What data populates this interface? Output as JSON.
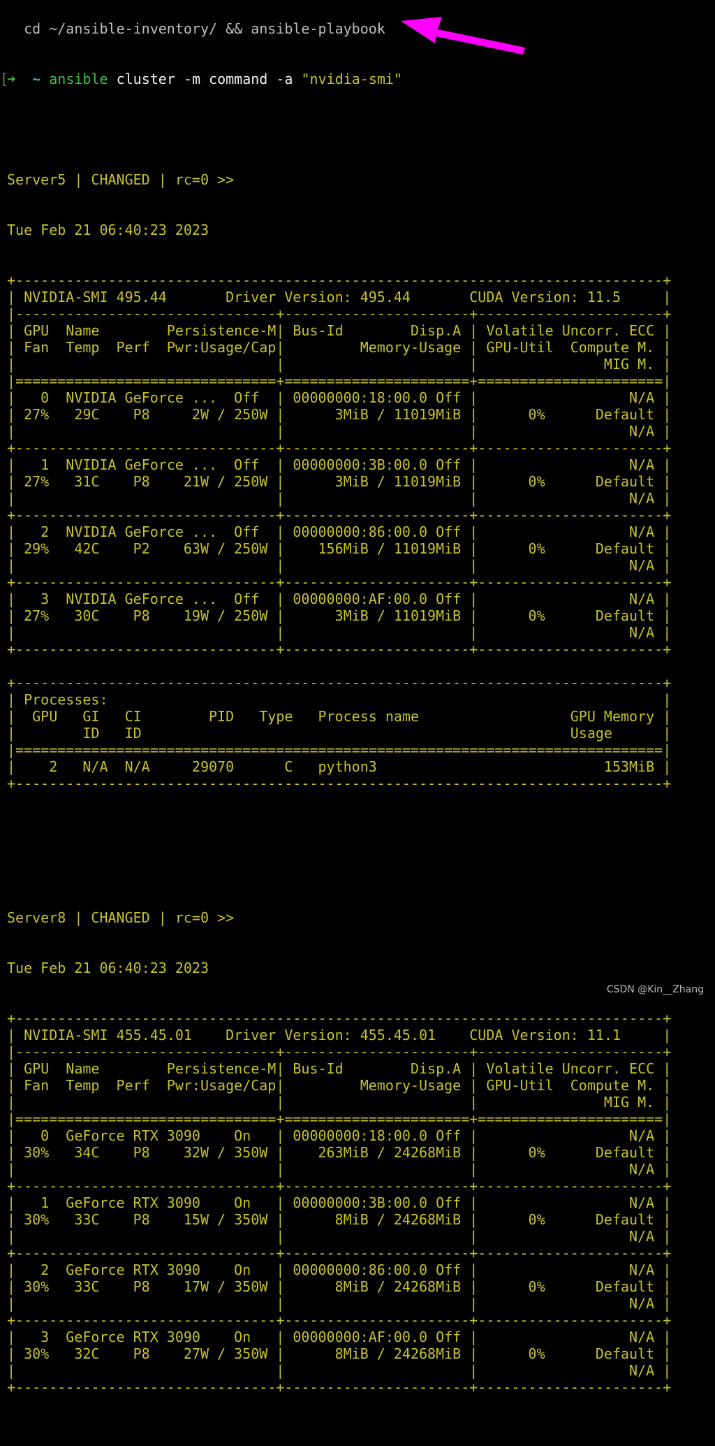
{
  "terminal": {
    "previous_line": "  cd ~/ansible-inventory/ && ansible-playbook",
    "prompt": {
      "bracket": "[",
      "arrow": "➜",
      "cwd": "~",
      "command": "ansible",
      "args": " cluster -m command -a ",
      "string_arg": "\"nvidia-smi\""
    },
    "annotation": {
      "type": "arrow-icon",
      "color": "#ff00ff",
      "points_to": "nvidia-smi command"
    },
    "servers": [
      {
        "header": "Server5 | CHANGED | rc=0 >>",
        "timestamp": "Tue Feb 21 06:40:23 2023",
        "smi_lines": [
          "+-----------------------------------------------------------------------------+",
          "| NVIDIA-SMI 495.44       Driver Version: 495.44       CUDA Version: 11.5     |",
          "|-------------------------------+----------------------+----------------------+",
          "| GPU  Name        Persistence-M| Bus-Id        Disp.A | Volatile Uncorr. ECC |",
          "| Fan  Temp  Perf  Pwr:Usage/Cap|         Memory-Usage | GPU-Util  Compute M. |",
          "|                               |                      |               MIG M. |",
          "|===============================+======================+======================|",
          "|   0  NVIDIA GeForce ...  Off  | 00000000:18:00.0 Off |                  N/A |",
          "| 27%   29C    P8     2W / 250W |      3MiB / 11019MiB |      0%      Default |",
          "|                               |                      |                  N/A |",
          "+-------------------------------+----------------------+----------------------+",
          "|   1  NVIDIA GeForce ...  Off  | 00000000:3B:00.0 Off |                  N/A |",
          "| 27%   31C    P8    21W / 250W |      3MiB / 11019MiB |      0%      Default |",
          "|                               |                      |                  N/A |",
          "+-------------------------------+----------------------+----------------------+",
          "|   2  NVIDIA GeForce ...  Off  | 00000000:86:00.0 Off |                  N/A |",
          "| 29%   42C    P2    63W / 250W |    156MiB / 11019MiB |      0%      Default |",
          "|                               |                      |                  N/A |",
          "+-------------------------------+----------------------+----------------------+",
          "|   3  NVIDIA GeForce ...  Off  | 00000000:AF:00.0 Off |                  N/A |",
          "| 27%   30C    P8    19W / 250W |      3MiB / 11019MiB |      0%      Default |",
          "|                               |                      |                  N/A |",
          "+-------------------------------+----------------------+----------------------+",
          "",
          "+-----------------------------------------------------------------------------+",
          "| Processes:                                                                  |",
          "|  GPU   GI   CI        PID   Type   Process name                  GPU Memory |",
          "|        ID   ID                                                   Usage      |",
          "|=============================================================================|",
          "|    2   N/A  N/A     29070      C   python3                           153MiB |",
          "+-----------------------------------------------------------------------------+"
        ],
        "summary": {
          "nvidia_smi_version": "495.44",
          "driver_version": "495.44",
          "cuda_version": "11.5",
          "gpus": [
            {
              "id": "0",
              "name": "NVIDIA GeForce ...",
              "persistence": "Off",
              "bus_id": "00000000:18:00.0",
              "disp": "Off",
              "ecc": "N/A",
              "fan": "27%",
              "temp": "29C",
              "perf": "P8",
              "power": "2W / 250W",
              "memory": "3MiB / 11019MiB",
              "util": "0%",
              "compute": "Default",
              "mig": "N/A"
            },
            {
              "id": "1",
              "name": "NVIDIA GeForce ...",
              "persistence": "Off",
              "bus_id": "00000000:3B:00.0",
              "disp": "Off",
              "ecc": "N/A",
              "fan": "27%",
              "temp": "31C",
              "perf": "P8",
              "power": "21W / 250W",
              "memory": "3MiB / 11019MiB",
              "util": "0%",
              "compute": "Default",
              "mig": "N/A"
            },
            {
              "id": "2",
              "name": "NVIDIA GeForce ...",
              "persistence": "Off",
              "bus_id": "00000000:86:00.0",
              "disp": "Off",
              "ecc": "N/A",
              "fan": "29%",
              "temp": "42C",
              "perf": "P2",
              "power": "63W / 250W",
              "memory": "156MiB / 11019MiB",
              "util": "0%",
              "compute": "Default",
              "mig": "N/A"
            },
            {
              "id": "3",
              "name": "NVIDIA GeForce ...",
              "persistence": "Off",
              "bus_id": "00000000:AF:00.0",
              "disp": "Off",
              "ecc": "N/A",
              "fan": "27%",
              "temp": "30C",
              "perf": "P8",
              "power": "19W / 250W",
              "memory": "3MiB / 11019MiB",
              "util": "0%",
              "compute": "Default",
              "mig": "N/A"
            }
          ],
          "processes": [
            {
              "gpu": "2",
              "gi_id": "N/A",
              "ci_id": "N/A",
              "pid": "29070",
              "type": "C",
              "name": "python3",
              "memory": "153MiB"
            }
          ]
        }
      },
      {
        "header": "Server8 | CHANGED | rc=0 >>",
        "timestamp": "Tue Feb 21 06:40:23 2023",
        "smi_lines": [
          "+-----------------------------------------------------------------------------+",
          "| NVIDIA-SMI 455.45.01    Driver Version: 455.45.01    CUDA Version: 11.1     |",
          "|-------------------------------+----------------------+----------------------+",
          "| GPU  Name        Persistence-M| Bus-Id        Disp.A | Volatile Uncorr. ECC |",
          "| Fan  Temp  Perf  Pwr:Usage/Cap|         Memory-Usage | GPU-Util  Compute M. |",
          "|                               |                      |               MIG M. |",
          "|===============================+======================+======================|",
          "|   0  GeForce RTX 3090    On   | 00000000:18:00.0 Off |                  N/A |",
          "| 30%   34C    P8    32W / 350W |    263MiB / 24268MiB |      0%      Default |",
          "|                               |                      |                  N/A |",
          "+-------------------------------+----------------------+----------------------+",
          "|   1  GeForce RTX 3090    On   | 00000000:3B:00.0 Off |                  N/A |",
          "| 30%   33C    P8    15W / 350W |      8MiB / 24268MiB |      0%      Default |",
          "|                               |                      |                  N/A |",
          "+-------------------------------+----------------------+----------------------+",
          "|   2  GeForce RTX 3090    On   | 00000000:86:00.0 Off |                  N/A |",
          "| 30%   33C    P8    17W / 350W |      8MiB / 24268MiB |      0%      Default |",
          "|                               |                      |                  N/A |",
          "+-------------------------------+----------------------+----------------------+",
          "|   3  GeForce RTX 3090    On   | 00000000:AF:00.0 Off |                  N/A |",
          "| 30%   32C    P8    27W / 350W |      8MiB / 24268MiB |      0%      Default |",
          "|                               |                      |                  N/A |",
          "+-------------------------------+----------------------+----------------------+"
        ],
        "summary": {
          "nvidia_smi_version": "455.45.01",
          "driver_version": "455.45.01",
          "cuda_version": "11.1",
          "gpus": [
            {
              "id": "0",
              "name": "GeForce RTX 3090",
              "persistence": "On",
              "bus_id": "00000000:18:00.0",
              "disp": "Off",
              "ecc": "N/A",
              "fan": "30%",
              "temp": "34C",
              "perf": "P8",
              "power": "32W / 350W",
              "memory": "263MiB / 24268MiB",
              "util": "0%",
              "compute": "Default",
              "mig": "N/A"
            },
            {
              "id": "1",
              "name": "GeForce RTX 3090",
              "persistence": "On",
              "bus_id": "00000000:3B:00.0",
              "disp": "Off",
              "ecc": "N/A",
              "fan": "30%",
              "temp": "33C",
              "perf": "P8",
              "power": "15W / 350W",
              "memory": "8MiB / 24268MiB",
              "util": "0%",
              "compute": "Default",
              "mig": "N/A"
            },
            {
              "id": "2",
              "name": "GeForce RTX 3090",
              "persistence": "On",
              "bus_id": "00000000:86:00.0",
              "disp": "Off",
              "ecc": "N/A",
              "fan": "30%",
              "temp": "33C",
              "perf": "P8",
              "power": "17W / 350W",
              "memory": "8MiB / 24268MiB",
              "util": "0%",
              "compute": "Default",
              "mig": "N/A"
            },
            {
              "id": "3",
              "name": "GeForce RTX 3090",
              "persistence": "On",
              "bus_id": "00000000:AF:00.0",
              "disp": "Off",
              "ecc": "N/A",
              "fan": "30%",
              "temp": "32C",
              "perf": "P8",
              "power": "27W / 350W",
              "memory": "8MiB / 24268MiB",
              "util": "0%",
              "compute": "Default",
              "mig": "N/A"
            }
          ],
          "processes": []
        }
      }
    ]
  },
  "watermark": "CSDN @Kin__Zhang"
}
